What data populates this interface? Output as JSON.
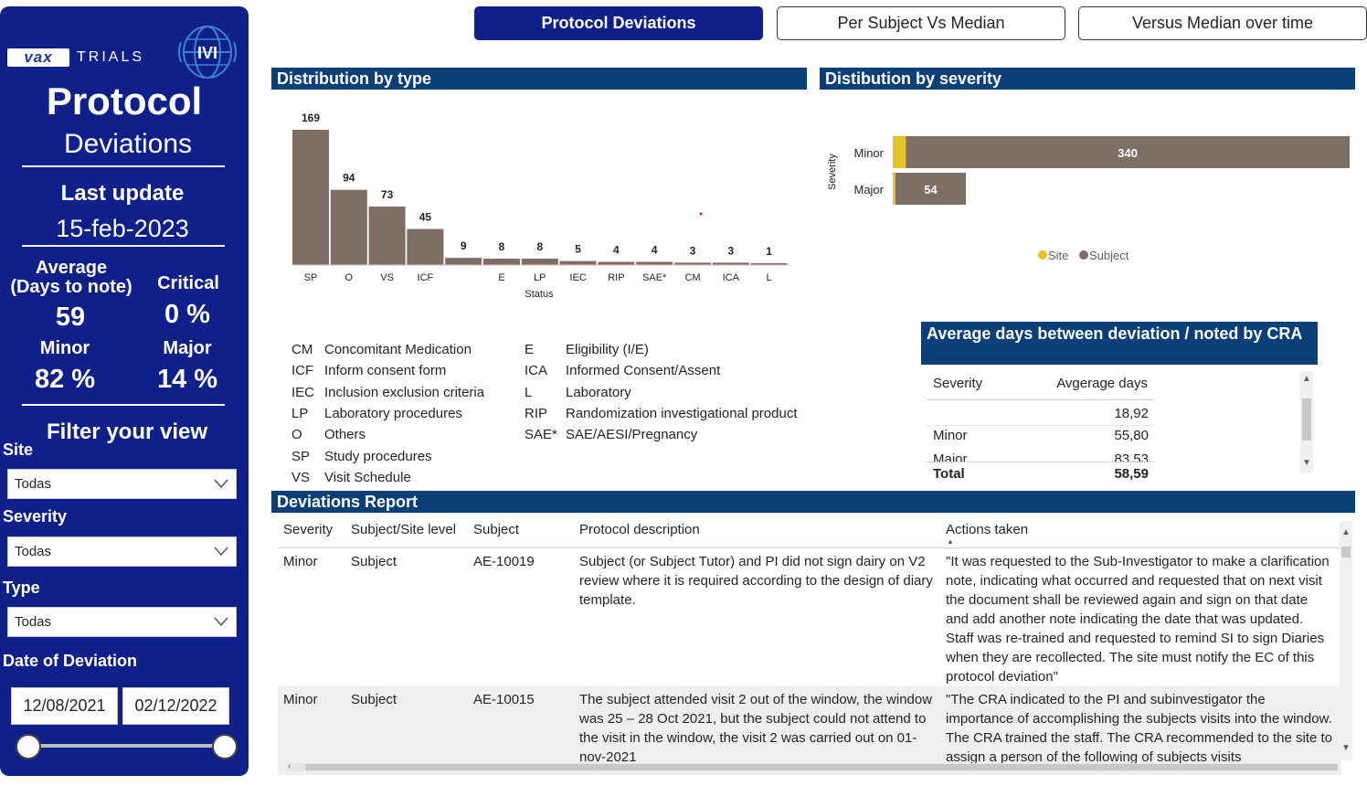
{
  "sidebar": {
    "logo_vax": "vax",
    "logo_trials": "TRIALS",
    "logo_ivi": "IVI",
    "title": "Protocol",
    "subtitle": "Deviations",
    "last_update_label": "Last update",
    "last_update_value": "15-feb-2023",
    "kpis": {
      "average_label_line1": "Average",
      "average_label_line2": "(Days to note)",
      "average_value": "59",
      "critical_label": "Critical",
      "critical_value": "0 %",
      "minor_label": "Minor",
      "minor_value": "82 %",
      "major_label": "Major",
      "major_value": "14 %"
    },
    "filter_title": "Filter your view",
    "filters": {
      "site_label": "Site",
      "site_value": "Todas",
      "severity_label": "Severity",
      "severity_value": "Todas",
      "type_label": "Type",
      "type_value": "Todas",
      "date_label": "Date of Deviation",
      "date_from": "12/08/2021",
      "date_to": "02/12/2022"
    }
  },
  "nav": {
    "tabs": [
      {
        "label": "Protocol Deviations",
        "active": true
      },
      {
        "label": "Per Subject Vs Median",
        "active": false
      },
      {
        "label": "Versus Median over time",
        "active": false
      }
    ]
  },
  "type_chart": {
    "header": "Distribution by type",
    "xlabel": "Status",
    "color": "#7e6e66"
  },
  "severity_chart": {
    "header": "Distibution by severity",
    "ylabel": "Severity",
    "site_color": "#e6c229",
    "subject_color": "#7e6e66"
  },
  "abbreviations": {
    "left": [
      {
        "code": "CM",
        "text": "Concomitant Medication"
      },
      {
        "code": "ICF",
        "text": "Inform consent form"
      },
      {
        "code": "IEC",
        "text": "Inclusion exclusion criteria"
      },
      {
        "code": "LP",
        "text": "Laboratory procedures"
      },
      {
        "code": "O",
        "text": "Others"
      },
      {
        "code": "SP",
        "text": "Study procedures"
      },
      {
        "code": "VS",
        "text": "Visit Schedule"
      }
    ],
    "right": [
      {
        "code": "E",
        "text": "Eligibility (I/E)"
      },
      {
        "code": "ICA",
        "text": "Informed Consent/Assent"
      },
      {
        "code": "L",
        "text": "Laboratory"
      },
      {
        "code": "RIP",
        "text": "Randomization investigational product"
      },
      {
        "code": "SAE*",
        "text": "SAE/AESI/Pregnancy"
      }
    ]
  },
  "avg_table": {
    "header": "Average days between deviation / noted by CRA",
    "col_severity": "Severity",
    "col_days": "Avgerage days",
    "rows": [
      {
        "severity": "",
        "days": "18,92"
      },
      {
        "severity": "Minor",
        "days": "55,80"
      },
      {
        "severity": "Major",
        "days": "83,53"
      }
    ],
    "total_label": "Total",
    "total_value": "58,59"
  },
  "report": {
    "header": "Deviations Report",
    "columns": [
      "Severity",
      "Subject/Site level",
      "Subject",
      "Protocol description",
      "Actions taken"
    ],
    "rows": [
      {
        "severity": "Minor",
        "level": "Subject",
        "subject": "AE-10019",
        "description": "Subject (or Subject Tutor) and PI did not sign dairy on V2 review where it is required according to the design of diary template.",
        "actions": "\"It was requested to the Sub-Investigator to make a clarification note, indicating what occurred and requested that on next visit the document shall be reviewed again and sign on that date and add another note indicating the date that was updated. Staff was re-trained and requested to remind SI to sign Diaries when they are recollected. The site must notify the EC of this protocol deviation\""
      },
      {
        "severity": "Minor",
        "level": "Subject",
        "subject": "AE-10015",
        "description": "The subject attended visit 2 out of the window, the window was 25 – 28 Oct 2021, but the subject could not attend to the visit in the window, the visit 2 was carried out on 01-nov-2021",
        "actions": "\"The CRA indicated to the PI and subinvestigator the importance of accomplishing the subjects visits into the window. The CRA trained the staff. The CRA recommended to the site to assign a person of the following of subjects visits"
      }
    ]
  },
  "chart_data": [
    {
      "type": "bar",
      "title": "Distribution by type",
      "xlabel": "Status",
      "categories": [
        "SP",
        "O",
        "VS",
        "ICF",
        "",
        "E",
        "LP",
        "IEC",
        "RIP",
        "SAE*",
        "CM",
        "ICA",
        "L"
      ],
      "values": [
        169,
        94,
        73,
        45,
        9,
        8,
        8,
        5,
        4,
        4,
        3,
        3,
        1
      ]
    },
    {
      "type": "bar",
      "orientation": "horizontal",
      "stacked": true,
      "title": "Distibution by severity",
      "ylabel": "Severity",
      "categories": [
        "Minor",
        "Major"
      ],
      "series": [
        {
          "name": "Site",
          "values": [
            10,
            2
          ]
        },
        {
          "name": "Subject",
          "values": [
            340,
            54
          ]
        }
      ],
      "legend": "bottom-center"
    }
  ]
}
